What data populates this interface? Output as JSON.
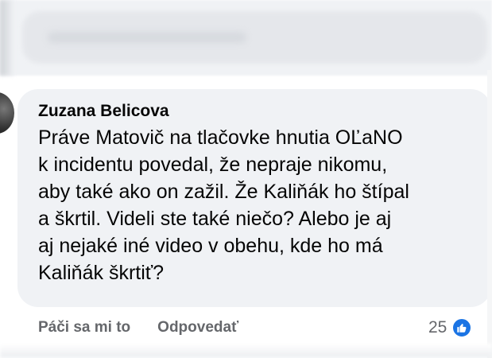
{
  "comment": {
    "author": "Zuzana Belicova",
    "text_lines": [
      "Práve Matovič na tlačovke hnutia OĽaNO",
      "k incidentu povedal, že nepraje nikomu,",
      "aby také ako on zažil. Že Kaliňák ho štípal",
      "a škrtil. Videli ste také niečo? Alebo je aj",
      "aj nejaké iné video v obehu, kde ho má",
      "Kaliňák škrtiť?"
    ],
    "actions": {
      "like_label": "Páči sa mi to",
      "reply_label": "Odpovedať"
    },
    "reactions": {
      "count": "25",
      "icon": "like-thumb-icon"
    }
  },
  "colors": {
    "bubble": "#f0f2f5",
    "text": "#050505",
    "secondary_text": "#65676b",
    "like_blue": "#1b74e4"
  }
}
